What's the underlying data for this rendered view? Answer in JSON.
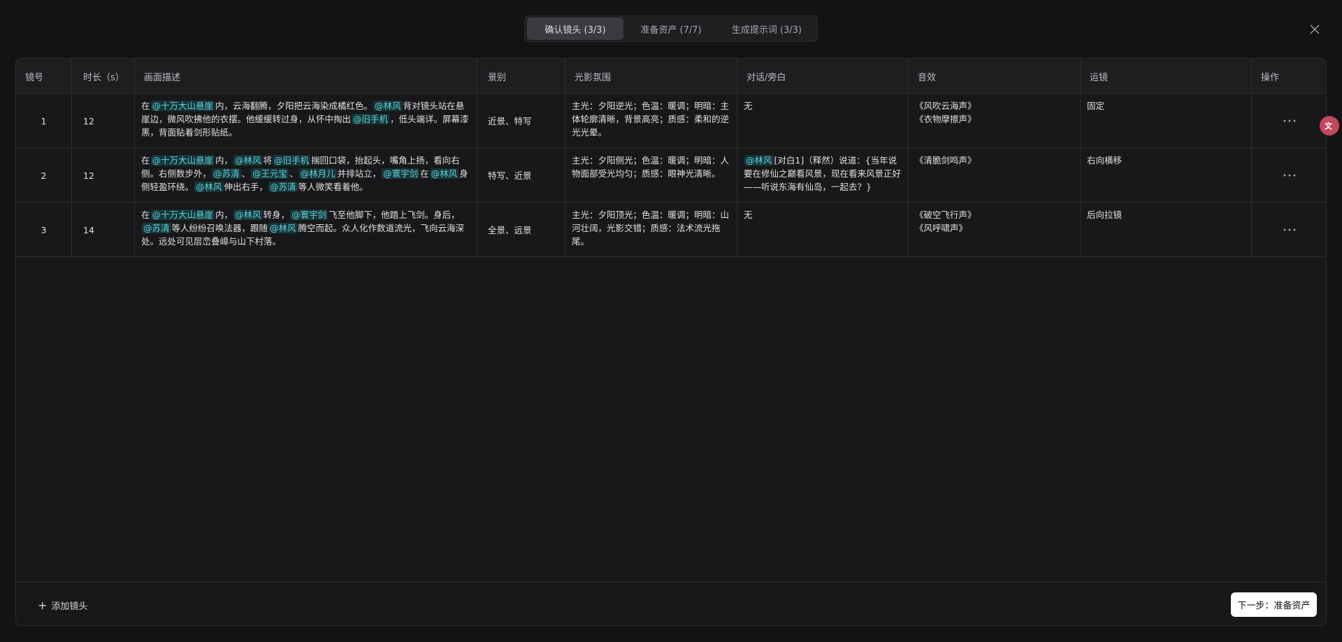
{
  "tabs": [
    {
      "label": "确认镜头 (3/3)",
      "active": true
    },
    {
      "label": "准备资产 (7/7)",
      "active": false
    },
    {
      "label": "生成提示词 (3/3)",
      "active": false
    }
  ],
  "table": {
    "columns": [
      "镜号",
      "时长（s）",
      "画面描述",
      "景别",
      "光影氛围",
      "对话/旁白",
      "音效",
      "运镜",
      "操作"
    ],
    "rows": [
      {
        "num": "1",
        "duration": "12",
        "description": [
          {
            "t": "在"
          },
          {
            "tag": "@十万大山悬崖"
          },
          {
            "t": "内，云海翻腾，夕阳把云海染成橘红色。"
          },
          {
            "tag": "@林风"
          },
          {
            "t": "背对镜头站在悬崖边，微风吹拂他的衣摆。他缓缓转过身，从怀中掏出"
          },
          {
            "tag": "@旧手机"
          },
          {
            "t": "，低头端详。屏幕漆黑，背面贴着剑形贴纸。"
          }
        ],
        "scene": "近景、特写",
        "lighting": "主光：夕阳逆光；色温：暖调；明暗：主体轮廓清晰，背景高亮；质感：柔和的逆光光晕。",
        "dialogue": [
          {
            "t": "无"
          }
        ],
        "sfx": [
          "《风吹云海声》",
          "《衣物摩擦声》"
        ],
        "camera": "固定"
      },
      {
        "num": "2",
        "duration": "12",
        "description": [
          {
            "t": "在"
          },
          {
            "tag": "@十万大山悬崖"
          },
          {
            "t": "内，"
          },
          {
            "tag": "@林风"
          },
          {
            "t": "将"
          },
          {
            "tag": "@旧手机"
          },
          {
            "t": "揣回口袋，抬起头，嘴角上扬，看向右侧。右侧数步外，"
          },
          {
            "tag": "@苏清"
          },
          {
            "t": "、"
          },
          {
            "tag": "@王元宝"
          },
          {
            "t": "、"
          },
          {
            "tag": "@林月儿"
          },
          {
            "t": "并排站立，"
          },
          {
            "tag": "@寰宇剑"
          },
          {
            "t": "在"
          },
          {
            "tag": "@林风"
          },
          {
            "t": "身侧轻盈环绕。"
          },
          {
            "tag": "@林风"
          },
          {
            "t": "伸出右手，"
          },
          {
            "tag": "@苏清"
          },
          {
            "t": "等人微笑看着他。"
          }
        ],
        "scene": "特写、近景",
        "lighting": "主光：夕阳侧光；色温：暖调；明暗：人物面部受光均匀；质感：眼神光清晰。",
        "dialogue": [
          {
            "tag": "@林风"
          },
          {
            "t": "[对白1]（释然）说道：{当年说要在修仙之巅看风景，现在看来风景正好——听说东海有仙岛，一起去？}"
          }
        ],
        "sfx": [
          "《清脆剑鸣声》"
        ],
        "camera": "右向横移"
      },
      {
        "num": "3",
        "duration": "14",
        "description": [
          {
            "t": "在"
          },
          {
            "tag": "@十万大山悬崖"
          },
          {
            "t": "内，"
          },
          {
            "tag": "@林风"
          },
          {
            "t": "转身，"
          },
          {
            "tag": "@寰宇剑"
          },
          {
            "t": "飞至他脚下，他踏上飞剑。身后，"
          },
          {
            "tag": "@苏清"
          },
          {
            "t": "等人纷纷召唤法器，跟随"
          },
          {
            "tag": "@林风"
          },
          {
            "t": "腾空而起。众人化作数道流光，飞向云海深处。远处可见层峦叠嶂与山下村落。"
          }
        ],
        "scene": "全景、远景",
        "lighting": "主光：夕阳顶光；色温：暖调；明暗：山河壮阔，光影交错；质感：法术流光拖尾。",
        "dialogue": [
          {
            "t": "无"
          }
        ],
        "sfx": [
          "《破空飞行声》",
          "《风呼啸声》"
        ],
        "camera": "后向拉镜"
      }
    ]
  },
  "footer": {
    "add_label": "添加镜头",
    "next_label": "下一步：准备资产"
  },
  "icons": {
    "close": "close-icon",
    "plus": "plus-icon",
    "more": "more-icon",
    "drag": "drag-handle-icon",
    "translate": "translate-icon"
  },
  "colors": {
    "background": "#131315",
    "panel": "#18181a",
    "tag_bg": "#17363a",
    "tag_text": "#5fd0d6",
    "translate_badge": "#c3475f"
  }
}
